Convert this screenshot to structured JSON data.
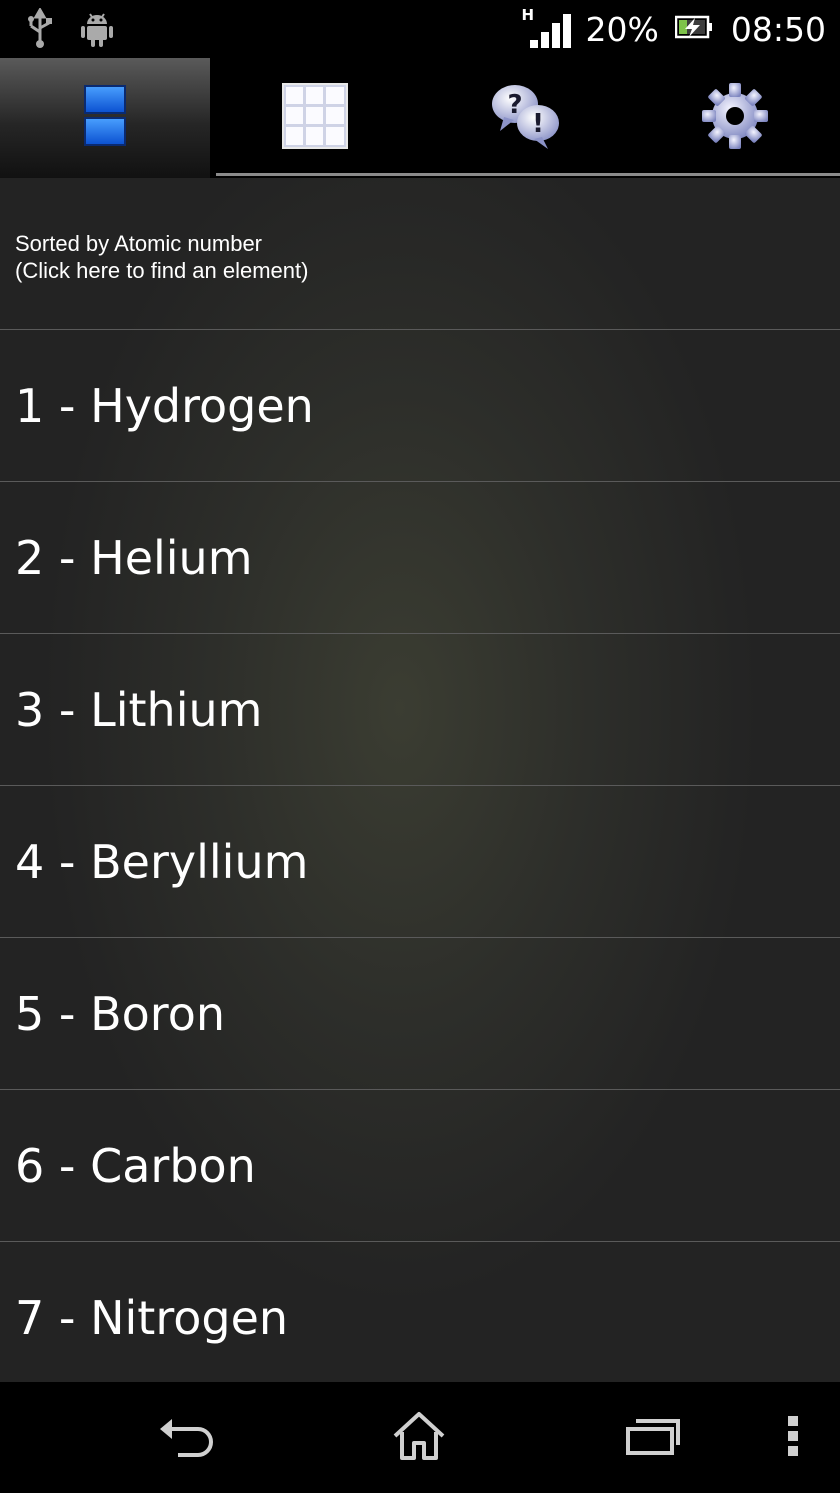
{
  "status_bar": {
    "network_type": "H",
    "battery_percent": "20%",
    "time": "08:50",
    "icons": [
      "usb-icon",
      "android-icon",
      "signal-icon",
      "battery-charging-icon"
    ]
  },
  "tabs": [
    {
      "name": "list-view",
      "icon": "list-view-icon",
      "active": true
    },
    {
      "name": "table-view",
      "icon": "grid-table-icon",
      "active": false
    },
    {
      "name": "quiz",
      "icon": "quiz-bubbles-icon",
      "active": false
    },
    {
      "name": "settings",
      "icon": "gear-icon",
      "active": false
    }
  ],
  "sort_header": {
    "line1": "Sorted by Atomic number",
    "line2": "(Click here to find an element)"
  },
  "elements": [
    "1 - Hydrogen",
    "2 - Helium",
    "3 - Lithium",
    "4 - Beryllium",
    "5 - Boron",
    "6 - Carbon",
    "7 - Nitrogen"
  ],
  "nav_bar": {
    "icons": [
      "back-icon",
      "home-icon",
      "recent-apps-icon",
      "overflow-menu-icon"
    ]
  },
  "colors": {
    "accent_blue": "#1f6fe6",
    "divider": "#5a5a5a",
    "background": "#262626"
  }
}
